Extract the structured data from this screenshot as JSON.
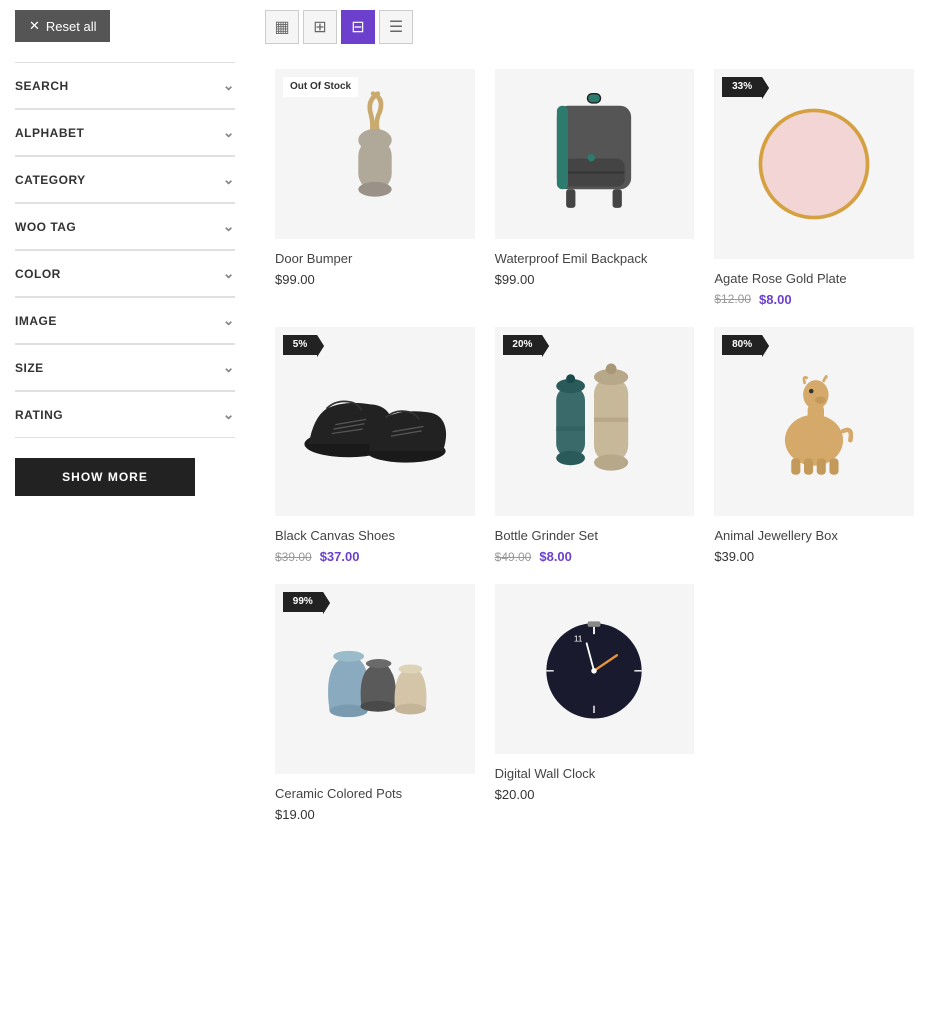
{
  "sidebar": {
    "reset_label": "Reset all",
    "filters": [
      {
        "id": "search",
        "label": "SEARCH"
      },
      {
        "id": "alphabet",
        "label": "ALPHABET"
      },
      {
        "id": "category",
        "label": "CATEGORY"
      },
      {
        "id": "woo_tag",
        "label": "WOO TAG"
      },
      {
        "id": "color",
        "label": "COLOR"
      },
      {
        "id": "image",
        "label": "IMAGE"
      },
      {
        "id": "size",
        "label": "SIZE"
      },
      {
        "id": "rating",
        "label": "RATING"
      }
    ],
    "show_more_label": "SHOW MORE"
  },
  "grid_controls": [
    {
      "id": "two-col",
      "icon": "▦",
      "active": false
    },
    {
      "id": "three-col",
      "icon": "⊞",
      "active": false
    },
    {
      "id": "four-col",
      "icon": "⊟",
      "active": true
    },
    {
      "id": "list",
      "icon": "☰",
      "active": false
    }
  ],
  "products": [
    {
      "id": "door-bumper",
      "name": "Door Bumper",
      "badge": "Out Of Stock",
      "badge_type": "out",
      "price": "$99.00",
      "original_price": null,
      "image_type": "door-bumper"
    },
    {
      "id": "waterproof-backpack",
      "name": "Waterproof Emil Backpack",
      "badge": null,
      "badge_type": null,
      "price": "$99.00",
      "original_price": null,
      "image_type": "backpack"
    },
    {
      "id": "agate-plate",
      "name": "Agate Rose Gold Plate",
      "badge": "33%",
      "badge_type": "discount",
      "price": "$8.00",
      "original_price": "$12.00",
      "image_type": "plate"
    },
    {
      "id": "black-shoes",
      "name": "Black Canvas Shoes",
      "badge": "5%",
      "badge_type": "discount",
      "price": "$37.00",
      "original_price": "$39.00",
      "image_type": "shoes"
    },
    {
      "id": "bottle-grinder",
      "name": "Bottle Grinder Set",
      "badge": "20%",
      "badge_type": "discount",
      "price": "$8.00",
      "original_price": "$49.00",
      "image_type": "grinder"
    },
    {
      "id": "animal-jewellery",
      "name": "Animal Jewellery Box",
      "badge": "80%",
      "badge_type": "discount",
      "price": "$39.00",
      "original_price": null,
      "image_type": "animal"
    },
    {
      "id": "ceramic-pots",
      "name": "Ceramic Colored Pots",
      "badge": "99%",
      "badge_type": "discount",
      "price": "$19.00",
      "original_price": null,
      "image_type": "pots"
    },
    {
      "id": "digital-clock",
      "name": "Digital Wall Clock",
      "badge": null,
      "badge_type": null,
      "price": "$20.00",
      "original_price": null,
      "image_type": "clock"
    }
  ]
}
